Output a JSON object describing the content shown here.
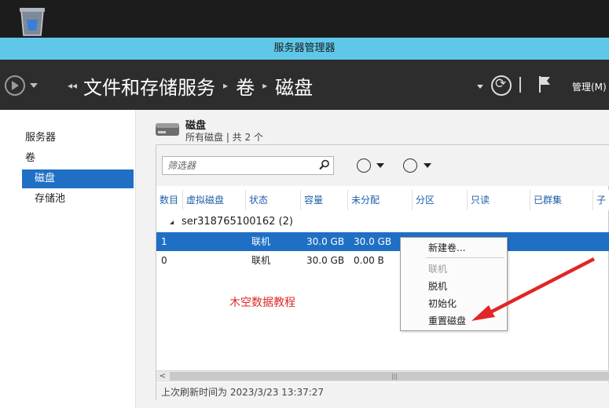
{
  "window": {
    "title": "服务器管理器"
  },
  "header": {
    "breadcrumb": [
      "文件和存储服务",
      "卷",
      "磁盘"
    ],
    "lead_glyph": "◂◂",
    "separator": "▸",
    "manage_label": "管理(M)"
  },
  "sidebar": {
    "items": [
      {
        "label": "服务器",
        "active": false
      },
      {
        "label": "卷",
        "active": false
      },
      {
        "label": "磁盘",
        "active": true
      },
      {
        "label": "存储池",
        "active": false
      }
    ]
  },
  "section": {
    "title": "磁盘",
    "subtitle": "所有磁盘 | 共 2 个"
  },
  "filter": {
    "placeholder": "筛选器"
  },
  "table": {
    "columns": [
      "数目",
      "虚拟磁盘",
      "状态",
      "容量",
      "未分配",
      "分区",
      "只读",
      "已群集",
      "子"
    ],
    "group": "ser318765100162 (2)",
    "rows": [
      {
        "number": "1",
        "status": "联机",
        "capacity": "30.0 GB",
        "unallocated": "30.0 GB",
        "selected": true
      },
      {
        "number": "0",
        "status": "联机",
        "capacity": "30.0 GB",
        "unallocated": "0.00 B",
        "selected": false
      }
    ]
  },
  "context_menu": {
    "items": [
      {
        "label": "新建卷...",
        "enabled": true
      },
      {
        "label": "联机",
        "enabled": false
      },
      {
        "label": "脱机",
        "enabled": true
      },
      {
        "label": "初始化",
        "enabled": true
      },
      {
        "label": "重置磁盘",
        "enabled": true
      }
    ]
  },
  "watermark": "木空数据教程",
  "status_bar": {
    "last_refresh": "上次刷新时间为 2023/3/23 13:37:27"
  },
  "colors": {
    "titlebar": "#5fc8e8",
    "header_bg": "#2d2d2d",
    "selection": "#1f6fc5",
    "annotation_red": "#e02626"
  },
  "icons": [
    "recycle-bin-icon",
    "back-arrow-icon",
    "refresh-icon",
    "flag-icon",
    "disk-icon",
    "search-icon",
    "list-options-icon",
    "save-options-icon",
    "red-arrow-annotation"
  ]
}
